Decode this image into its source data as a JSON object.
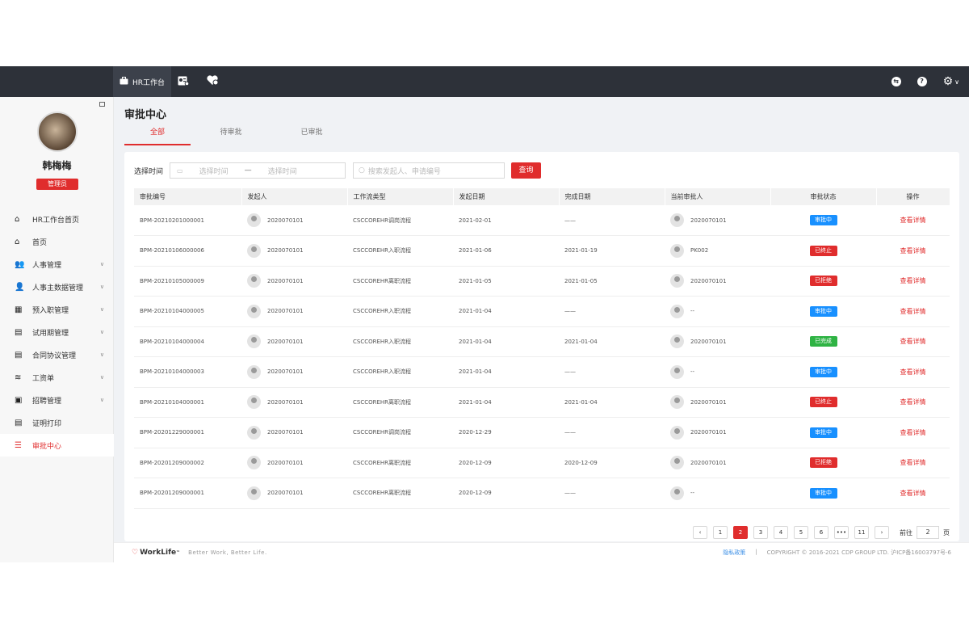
{
  "header": {
    "nav": [
      {
        "label": "HR工作台",
        "icon": "briefcase-icon"
      },
      {
        "label": "",
        "icon": "id-card-icon"
      },
      {
        "label": "",
        "icon": "heart-hands-icon"
      }
    ],
    "right_icons": [
      "message-icon",
      "help-icon",
      "gear-icon"
    ]
  },
  "user": {
    "name": "韩梅梅",
    "role": "管理员"
  },
  "sidebar": {
    "items": [
      {
        "label": "HR工作台首页",
        "icon": "home-icon",
        "expandable": false
      },
      {
        "label": "首页",
        "icon": "home-icon",
        "expandable": false
      },
      {
        "label": "人事管理",
        "icon": "users-icon",
        "expandable": true
      },
      {
        "label": "人事主数据管理",
        "icon": "user-data-icon",
        "expandable": true
      },
      {
        "label": "预入职管理",
        "icon": "calendar-icon",
        "expandable": true
      },
      {
        "label": "试用期管理",
        "icon": "document-icon",
        "expandable": true
      },
      {
        "label": "合同协议管理",
        "icon": "contract-icon",
        "expandable": true
      },
      {
        "label": "工资单",
        "icon": "database-icon",
        "expandable": true
      },
      {
        "label": "招聘管理",
        "icon": "recruit-icon",
        "expandable": true
      },
      {
        "label": "证明打印",
        "icon": "print-icon",
        "expandable": false
      },
      {
        "label": "审批中心",
        "icon": "list-icon",
        "expandable": false,
        "active": true
      }
    ]
  },
  "page": {
    "title": "审批中心",
    "tabs": [
      {
        "label": "全部",
        "active": true
      },
      {
        "label": "待审批",
        "active": false
      },
      {
        "label": "已审批",
        "active": false
      }
    ]
  },
  "filter": {
    "time_label": "选择时间",
    "start_placeholder": "选择时间",
    "separator": "—",
    "end_placeholder": "选择时间",
    "search_placeholder": "搜索发起人、申请编号",
    "query_button": "查询"
  },
  "table": {
    "headers": [
      "审批编号",
      "发起人",
      "工作流类型",
      "发起日期",
      "完成日期",
      "当前审批人",
      "审批状态",
      "操作"
    ],
    "rows": [
      {
        "id": "BPM-20210201000001",
        "initiator": "2020070101",
        "type": "CSCCOREHR调岗流程",
        "start": "2021-02-01",
        "end": "——",
        "approver": "2020070101",
        "status": "审批中",
        "status_color": "#1890ff",
        "action": "查看详情"
      },
      {
        "id": "BPM-20210106000006",
        "initiator": "2020070101",
        "type": "CSCCOREHR入职流程",
        "start": "2021-01-06",
        "end": "2021-01-19",
        "approver": "PK002",
        "status": "已终止",
        "status_color": "#e02d2d",
        "action": "查看详情"
      },
      {
        "id": "BPM-20210105000009",
        "initiator": "2020070101",
        "type": "CSCCOREHR离职流程",
        "start": "2021-01-05",
        "end": "2021-01-05",
        "approver": "2020070101",
        "status": "已拒绝",
        "status_color": "#e02d2d",
        "action": "查看详情"
      },
      {
        "id": "BPM-20210104000005",
        "initiator": "2020070101",
        "type": "CSCCOREHR入职流程",
        "start": "2021-01-04",
        "end": "——",
        "approver": "--",
        "status": "审批中",
        "status_color": "#1890ff",
        "action": "查看详情"
      },
      {
        "id": "BPM-20210104000004",
        "initiator": "2020070101",
        "type": "CSCCOREHR入职流程",
        "start": "2021-01-04",
        "end": "2021-01-04",
        "approver": "2020070101",
        "status": "已完成",
        "status_color": "#2fb344",
        "action": "查看详情"
      },
      {
        "id": "BPM-20210104000003",
        "initiator": "2020070101",
        "type": "CSCCOREHR入职流程",
        "start": "2021-01-04",
        "end": "——",
        "approver": "--",
        "status": "审批中",
        "status_color": "#1890ff",
        "action": "查看详情"
      },
      {
        "id": "BPM-20210104000001",
        "initiator": "2020070101",
        "type": "CSCCOREHR离职流程",
        "start": "2021-01-04",
        "end": "2021-01-04",
        "approver": "2020070101",
        "status": "已终止",
        "status_color": "#e02d2d",
        "action": "查看详情"
      },
      {
        "id": "BPM-20201229000001",
        "initiator": "2020070101",
        "type": "CSCCOREHR调岗流程",
        "start": "2020-12-29",
        "end": "——",
        "approver": "2020070101",
        "status": "审批中",
        "status_color": "#1890ff",
        "action": "查看详情"
      },
      {
        "id": "BPM-20201209000002",
        "initiator": "2020070101",
        "type": "CSCCOREHR离职流程",
        "start": "2020-12-09",
        "end": "2020-12-09",
        "approver": "2020070101",
        "status": "已拒绝",
        "status_color": "#e02d2d",
        "action": "查看详情"
      },
      {
        "id": "BPM-20201209000001",
        "initiator": "2020070101",
        "type": "CSCCOREHR离职流程",
        "start": "2020-12-09",
        "end": "——",
        "approver": "--",
        "status": "审批中",
        "status_color": "#1890ff",
        "action": "查看详情"
      }
    ]
  },
  "pagination": {
    "prev": "‹",
    "pages": [
      "1",
      "2",
      "3",
      "4",
      "5",
      "6",
      "•••",
      "11"
    ],
    "current": "2",
    "next": "›",
    "goto_label": "前往",
    "goto_value": "2",
    "goto_suffix": "页"
  },
  "footer": {
    "logo": "WorkLife",
    "logo_tm": "™",
    "slogan": "Better Work, Better Life.",
    "privacy": "隐私政策",
    "divider": "|",
    "copyright": "COPYRIGHT © 2016-2021 CDP GROUP LTD. 沪ICP备16003797号-6"
  }
}
